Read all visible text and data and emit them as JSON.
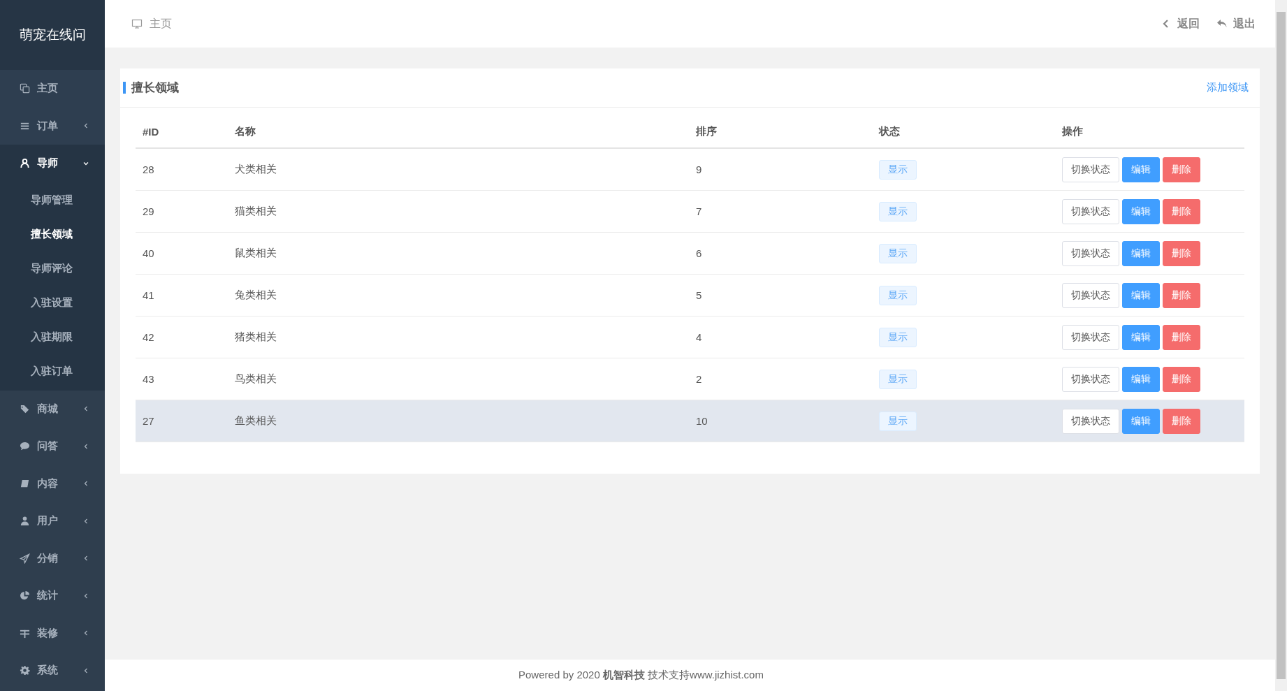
{
  "sidebar": {
    "logo": "萌宠在线问",
    "items": [
      {
        "label": "主页",
        "kind": "link",
        "expanded": false
      },
      {
        "label": "订单",
        "kind": "group",
        "expanded": false
      },
      {
        "label": "导师",
        "kind": "group",
        "expanded": true,
        "children": [
          {
            "label": "导师管理",
            "selected": false
          },
          {
            "label": "擅长领域",
            "selected": true
          },
          {
            "label": "导师评论",
            "selected": false
          },
          {
            "label": "入驻设置",
            "selected": false
          },
          {
            "label": "入驻期限",
            "selected": false
          },
          {
            "label": "入驻订单",
            "selected": false
          }
        ]
      },
      {
        "label": "商城",
        "kind": "group",
        "expanded": false
      },
      {
        "label": "问答",
        "kind": "group",
        "expanded": false
      },
      {
        "label": "内容",
        "kind": "group",
        "expanded": false
      },
      {
        "label": "用户",
        "kind": "group",
        "expanded": false
      },
      {
        "label": "分销",
        "kind": "group",
        "expanded": false
      },
      {
        "label": "统计",
        "kind": "group",
        "expanded": false
      },
      {
        "label": "装修",
        "kind": "group",
        "expanded": false
      },
      {
        "label": "系统",
        "kind": "group",
        "expanded": false
      }
    ]
  },
  "header": {
    "breadcrumb": "主页",
    "back": "返回",
    "logout": "退出"
  },
  "card": {
    "title": "擅长领域",
    "add_link": "添加领域"
  },
  "table": {
    "columns": [
      "#ID",
      "名称",
      "排序",
      "状态",
      "操作"
    ],
    "rows": [
      {
        "id": "28",
        "name": "犬类相关",
        "sort": "9",
        "status": "显示",
        "hovered": false,
        "actions": [
          "切换状态",
          "编辑",
          "删除"
        ]
      },
      {
        "id": "29",
        "name": "猫类相关",
        "sort": "7",
        "status": "显示",
        "hovered": false,
        "actions": [
          "切换状态",
          "编辑",
          "删除"
        ]
      },
      {
        "id": "40",
        "name": "鼠类相关",
        "sort": "6",
        "status": "显示",
        "hovered": false,
        "actions": [
          "切换状态",
          "编辑",
          "删除"
        ]
      },
      {
        "id": "41",
        "name": "兔类相关",
        "sort": "5",
        "status": "显示",
        "hovered": false,
        "actions": [
          "切换状态",
          "编辑",
          "删除"
        ]
      },
      {
        "id": "42",
        "name": "猪类相关",
        "sort": "4",
        "status": "显示",
        "hovered": false,
        "actions": [
          "切换状态",
          "编辑",
          "删除"
        ]
      },
      {
        "id": "43",
        "name": "鸟类相关",
        "sort": "2",
        "status": "显示",
        "hovered": false,
        "actions": [
          "切换状态",
          "编辑",
          "删除"
        ]
      },
      {
        "id": "27",
        "name": "鱼类相关",
        "sort": "10",
        "status": "显示",
        "hovered": true,
        "actions": [
          "切换状态",
          "编辑",
          "删除"
        ]
      }
    ]
  },
  "footer": "Powered by 2020 **机智科技** 技术支持www.jizhist.com"
}
